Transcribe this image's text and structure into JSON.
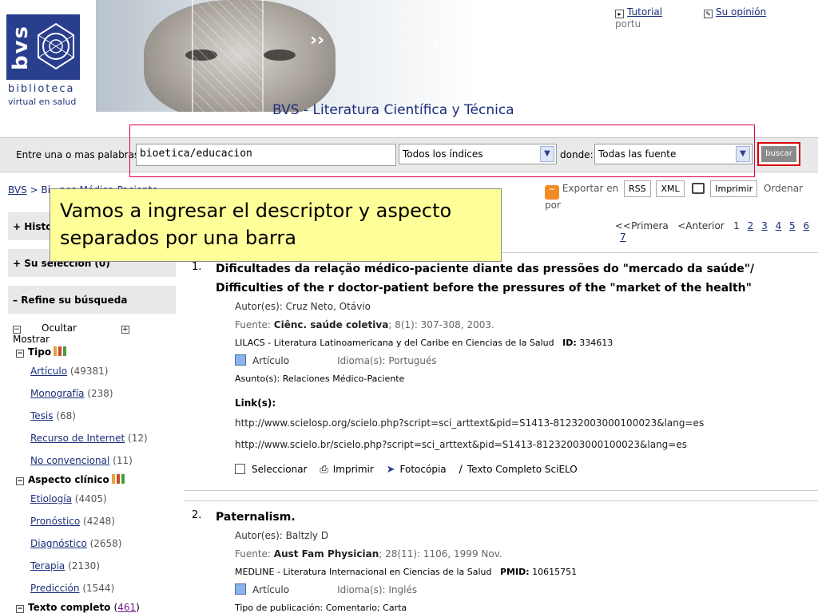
{
  "header": {
    "logo_bvs": "bvs",
    "logo_line1": "biblioteca",
    "logo_line2": "virtual en salud",
    "site_title": "BVS - Literatura Científica y Técnica",
    "link_tutorial": "Tutorial",
    "link_opinion": "Su opinión",
    "link_lang": "portu"
  },
  "search": {
    "label": "Entre una o mas palabras",
    "query": "bioetica/educacion",
    "index_select": "Todos los índices",
    "donde_label": "donde:",
    "source_select": "Todas las fuente",
    "button": "buscar"
  },
  "breadcrumb": {
    "home": "BVS",
    "sep": ">",
    "rest": "Bí...nes Médico-Paciente"
  },
  "toolbar": {
    "export_label": "Exportar en",
    "rss": "RSS",
    "xml": "XML",
    "print": "Imprimir",
    "order": "Ordenar por"
  },
  "callout": {
    "text": "Vamos a ingresar el descriptor y aspecto separados por una barra"
  },
  "sidebar": {
    "historial": "Histo",
    "seleccion": "Su selección (0)",
    "refine": "Refine su búsqueda",
    "ocultar": "Ocultar",
    "mostrar": "Mostrar",
    "tipo": {
      "title": "Tipo",
      "items": [
        {
          "label": "Artículo",
          "count": "(49381)"
        },
        {
          "label": "Monografía",
          "count": "(238)"
        },
        {
          "label": "Tesis",
          "count": "(68)"
        },
        {
          "label": "Recurso de Internet",
          "count": "(12)"
        },
        {
          "label": "No convencional",
          "count": "(11)"
        }
      ]
    },
    "aspecto": {
      "title": "Aspecto clínico",
      "items": [
        {
          "label": "Etiología",
          "count": "(4405)"
        },
        {
          "label": "Pronóstico",
          "count": "(4248)"
        },
        {
          "label": "Diagnóstico",
          "count": "(2658)"
        },
        {
          "label": "Terapia",
          "count": "(2130)"
        },
        {
          "label": "Predicción",
          "count": "(1544)"
        }
      ]
    },
    "texto": {
      "title": "Texto completo",
      "count_open": "(",
      "count": "461",
      "count_close": ")"
    }
  },
  "pager": {
    "first": "<<Primera",
    "prev": "<Anterior",
    "current": "1",
    "pages": [
      "2",
      "3",
      "4",
      "5",
      "6",
      "7"
    ]
  },
  "results": [
    {
      "num": "1.",
      "title": "Dificultades da relação médico-paciente diante das pressões do \"mercado da saúde\"/ Difficulties of the r doctor-patient before the pressures of the \"market of the health\"",
      "authors": "Autor(es): Cruz Neto, Otávio",
      "source_prefix": "Fuente: ",
      "source_journal": "Ciênc. saúde coletiva",
      "source_rest": "; 8(1): 307-308, 2003.",
      "db": "LILACS - Literatura Latinoamericana y del Caribe en Ciencias de la Salud",
      "id_label": "ID:",
      "id": "334613",
      "type": "Artículo",
      "lang": "Idioma(s): Portugués",
      "subject": "Asunto(s): Relaciones Médico-Paciente",
      "links_label": "Link(s):",
      "link1": "http://www.scielosp.org/scielo.php?script=sci_arttext&pid=S1413-81232003000100023&lang=es",
      "link2": "http://www.scielo.br/scielo.php?script=sci_arttext&pid=S1413-81232003000100023&lang=es",
      "act_select": "Seleccionar",
      "act_print": "Imprimir",
      "act_copy": "Fotocópia",
      "act_fulltext": "Texto Completo SciELO"
    },
    {
      "num": "2.",
      "title": "Paternalism.",
      "authors": "Autor(es): Baltzly D",
      "source_prefix": "Fuente: ",
      "source_journal": "Aust Fam Physician",
      "source_rest": "; 28(11): 1106, 1999 Nov.",
      "db": "MEDLINE - Literatura Internacional en Ciencias de la Salud",
      "id_label": "PMID:",
      "id": "10615751",
      "type": "Artículo",
      "lang": "Idioma(s): Inglés",
      "pubtype": "Tipo de publicación: Comentario; Carta"
    }
  ]
}
